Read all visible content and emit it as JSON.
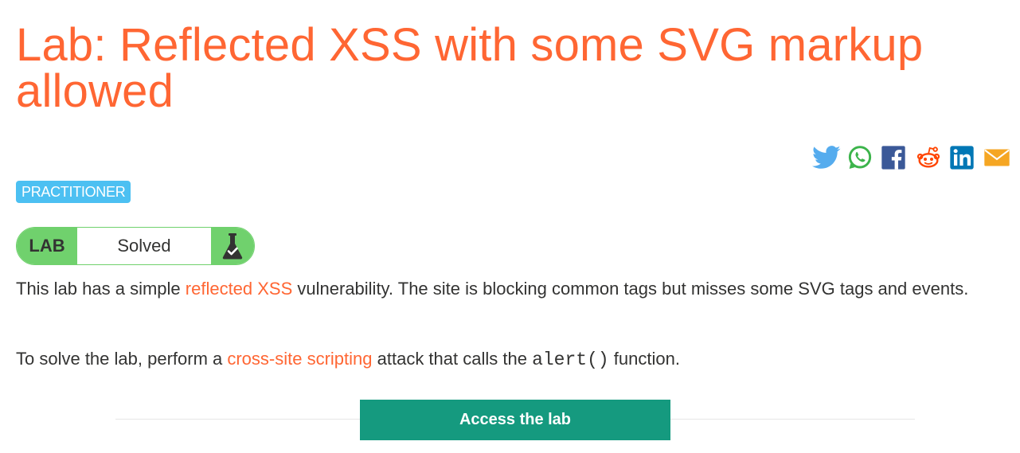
{
  "page": {
    "title": "Lab: Reflected XSS with some SVG markup allowed"
  },
  "share": {
    "items": [
      {
        "name": "twitter",
        "icon": "twitter-bird-icon",
        "color": "#55acee"
      },
      {
        "name": "whatsapp",
        "icon": "whatsapp-icon",
        "color": "#3cb44b"
      },
      {
        "name": "facebook",
        "icon": "facebook-icon",
        "color": "#3b5998"
      },
      {
        "name": "reddit",
        "icon": "reddit-alien-icon",
        "color": "#ff4500"
      },
      {
        "name": "linkedin",
        "icon": "linkedin-icon",
        "color": "#0077b5"
      },
      {
        "name": "email",
        "icon": "envelope-icon",
        "color": "#f5a623"
      }
    ]
  },
  "level": {
    "label": "PRACTITIONER",
    "color": "#4cc0f2"
  },
  "lab_status": {
    "tag": "LAB",
    "state": "Solved",
    "icon": "flask-check-icon",
    "color": "#70d16d"
  },
  "description": {
    "p1_before": "This lab has a simple ",
    "p1_link": "reflected XSS",
    "p1_after": " vulnerability. The site is blocking common tags but misses some SVG tags and events.",
    "p2_before": "To solve the lab, perform a ",
    "p2_link": "cross-site scripting",
    "p2_middle": " attack that calls the ",
    "p2_code": "alert()",
    "p2_after": " function."
  },
  "actions": {
    "access_label": "Access the lab",
    "access_color": "#159a7f"
  },
  "colors": {
    "accent": "#ff6633",
    "text": "#333332"
  }
}
